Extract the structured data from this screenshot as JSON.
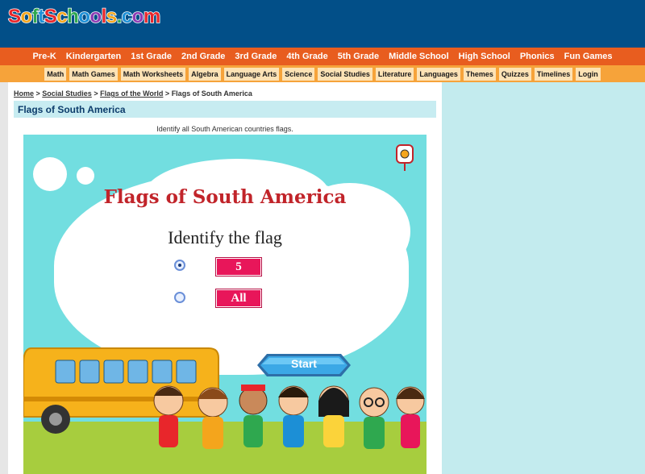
{
  "header": {
    "logo_letters": [
      {
        "ch": "S",
        "color": "#e8262b"
      },
      {
        "ch": "o",
        "color": "#f4a51c"
      },
      {
        "ch": "f",
        "color": "#2fa84f"
      },
      {
        "ch": "t",
        "color": "#1c8fd6"
      },
      {
        "ch": "S",
        "color": "#e8262b"
      },
      {
        "ch": "c",
        "color": "#f4a51c"
      },
      {
        "ch": "h",
        "color": "#2fa84f"
      },
      {
        "ch": "o",
        "color": "#1c8fd6"
      },
      {
        "ch": "o",
        "color": "#8d3bb3"
      },
      {
        "ch": "l",
        "color": "#e8262b"
      },
      {
        "ch": "s",
        "color": "#f4a51c"
      },
      {
        "ch": ".",
        "color": "#2fa84f"
      },
      {
        "ch": "c",
        "color": "#1c8fd6"
      },
      {
        "ch": "o",
        "color": "#8d3bb3"
      },
      {
        "ch": "m",
        "color": "#e8262b"
      }
    ]
  },
  "top_nav": [
    "Pre-K",
    "Kindergarten",
    "1st Grade",
    "2nd Grade",
    "3rd Grade",
    "4th Grade",
    "5th Grade",
    "Middle School",
    "High School",
    "Phonics",
    "Fun Games"
  ],
  "sub_nav": [
    "Math",
    "Math Games",
    "Math Worksheets",
    "Algebra",
    "Language Arts",
    "Science",
    "Social Studies",
    "Literature",
    "Languages",
    "Themes",
    "Quizzes",
    "Timelines",
    "Login"
  ],
  "breadcrumb": {
    "home": "Home",
    "sep": " > ",
    "social_studies": "Social Studies",
    "flags_world": "Flags of the World",
    "current": "Flags of South America"
  },
  "page_title": "Flags of South America",
  "instructions": "Identify all South American countries flags.",
  "game": {
    "title": "Flags of South America",
    "subtitle": "Identify the flag",
    "options": [
      {
        "label": "5",
        "checked": true
      },
      {
        "label": "All",
        "checked": false
      }
    ],
    "start_label": "Start"
  },
  "colors": {
    "header_bg": "#024f88",
    "top_nav_bg": "#e85d1f",
    "sub_nav_bg": "#f6a33a",
    "sidebar_bg": "#c3ebee",
    "game_bg": "#72dee0",
    "title_red": "#c1242a",
    "option_pink": "#e8165a"
  }
}
